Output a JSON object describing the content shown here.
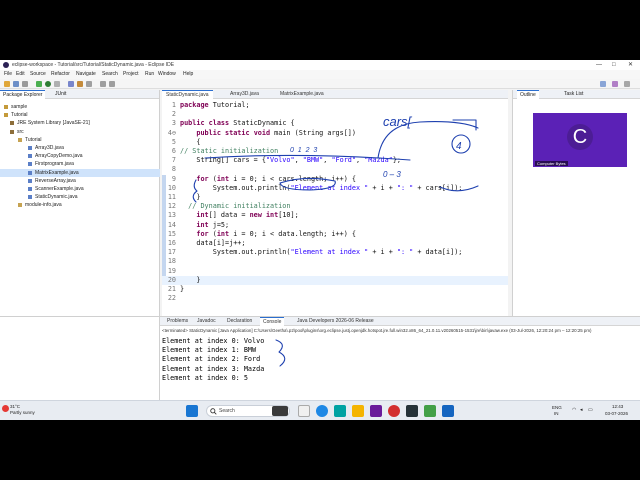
{
  "window": {
    "title": "eclipse-workspace - Tutorial/src/Tutorial/StaticDynamic.java - Eclipse IDE",
    "minimize": "—",
    "maximize": "□",
    "close": "✕"
  },
  "menu": [
    "File",
    "Edit",
    "Source",
    "Refactor",
    "Navigate",
    "Search",
    "Project",
    "Run",
    "Window",
    "Help"
  ],
  "package_explorer": {
    "tab_label": "Package Explorer",
    "tab2_label": "JUnit",
    "items": [
      {
        "label": "sample",
        "level": 0
      },
      {
        "label": "Tutorial",
        "level": 0
      },
      {
        "label": "JRE System Library [JavaSE-21]",
        "level": 1
      },
      {
        "label": "src",
        "level": 1
      },
      {
        "label": "Tutorial",
        "level": 2
      },
      {
        "label": "Array3D.java",
        "level": 3
      },
      {
        "label": "ArrayCopyDemo.java",
        "level": 3
      },
      {
        "label": "Firstprogram.java",
        "level": 3
      },
      {
        "label": "MatrixExample.java",
        "level": 3
      },
      {
        "label": "ReverseArray.java",
        "level": 3
      },
      {
        "label": "ScannerExample.java",
        "level": 3
      },
      {
        "label": "StaticDynamic.java",
        "level": 3
      },
      {
        "label": "module-info.java",
        "level": 2
      }
    ]
  },
  "editor": {
    "tabs": [
      "StaticDynamic.java",
      "Array3D.java",
      "MatrixExample.java"
    ],
    "lines": [
      {
        "n": "1",
        "code": "package Tutorial;"
      },
      {
        "n": "2",
        "code": ""
      },
      {
        "n": "3",
        "code": "public class StaticDynamic {"
      },
      {
        "n": "4⊖",
        "code": "    public static void main (String args[])"
      },
      {
        "n": "5",
        "code": "    {"
      },
      {
        "n": "6",
        "code": "// Static initialization"
      },
      {
        "n": "7",
        "code": "    String[] cars = {\"Volvo\", \"BMW\", \"Ford\", \"Mazda\"};"
      },
      {
        "n": "8",
        "code": ""
      },
      {
        "n": "9",
        "code": "    for (int i = 0; i < cars.length; i++) {"
      },
      {
        "n": "10",
        "code": "        System.out.println(\"Element at index \" + i + \": \" + cars[i]);"
      },
      {
        "n": "11",
        "code": "    }"
      },
      {
        "n": "12",
        "code": "  // Dynamic initialization"
      },
      {
        "n": "13",
        "code": "    int[] data = new int[10];"
      },
      {
        "n": "14",
        "code": "    int j=5;"
      },
      {
        "n": "15",
        "code": "    for (int i = 0; i < data.length; i++) {"
      },
      {
        "n": "16",
        "code": "    data[i]=j++;"
      },
      {
        "n": "17",
        "code": "        System.out.println(\"Element at index \" + i + \": \" + data[i]);"
      },
      {
        "n": "18",
        "code": ""
      },
      {
        "n": "19",
        "code": ""
      },
      {
        "n": "20",
        "code": "    }"
      },
      {
        "n": "21",
        "code": "}"
      },
      {
        "n": "22",
        "code": ""
      }
    ]
  },
  "outline": {
    "tab_label": "Outline",
    "tab2_label": "Task List"
  },
  "console": {
    "tabs": [
      "Problems",
      "Javadoc",
      "Declaration",
      "Console",
      "Java Developers 2026-06 Release"
    ],
    "terminated": "<terminated> StaticDynamic [Java Application] C:\\Users\\Geetha\\.p2\\pool\\plugins\\org.eclipse.justj.openjdk.hotspot.jre.full.win32.x86_64_21.0.11.v20260515-1531\\jre\\bin\\javaw.exe  (03-Jul-2026, 12:20:24 pm – 12:20:25 pm)",
    "output": [
      "Element at index 0: Volvo",
      "Element at index 1: BMW",
      "Element at index 2: Ford",
      "Element at index 3: Mazda",
      "Element at index 0: 5"
    ]
  },
  "annotations": {
    "cars_word": "cars[",
    "index_num": "4",
    "nums": "0  1  2  3",
    "range": "0 – 3"
  },
  "webcam": {
    "initial": "C",
    "name": "Computer Bytes"
  },
  "taskbar": {
    "weather_temp": "31°C",
    "weather_desc": "Partly sunny",
    "search_placeholder": "Search",
    "lang": "ENG",
    "region": "IN",
    "time": "12:43",
    "date": "03-07-2026"
  },
  "colors": {
    "keyword": "#7f0055",
    "string": "#2a00ff",
    "comment": "#3f7f5f",
    "ink": "#1e40af",
    "accent": "#2b6ecf"
  }
}
